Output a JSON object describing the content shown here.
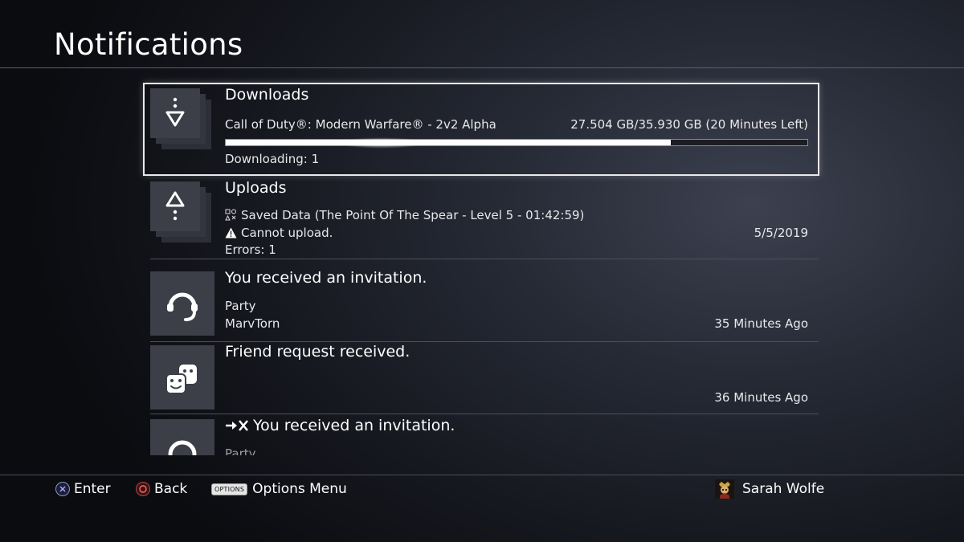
{
  "header": {
    "title": "Notifications"
  },
  "notifications": [
    {
      "title": "Downloads",
      "line1": "Call of Duty®: Modern Warfare® - 2v2 Alpha",
      "right1": "27.504 GB/35.930 GB (20 Minutes Left)",
      "progress_fraction": 0.765,
      "line3": "Downloading: 1",
      "icon": "download-icon"
    },
    {
      "title": "Uploads",
      "line1": "Saved Data (The Point Of The Spear - Level 5 - 01:42:59)",
      "line2": "Cannot upload.",
      "right2": "5/5/2019",
      "line3": "Errors: 1",
      "icon": "upload-icon"
    },
    {
      "title": "You received an invitation.",
      "line1": "Party",
      "line2": "MarvTorn",
      "right2": "35 Minutes Ago",
      "icon": "headset-icon"
    },
    {
      "title": "Friend request received.",
      "right2": "36 Minutes Ago",
      "icon": "friends-icon"
    },
    {
      "title": "You received an invitation.",
      "line1": "Party",
      "icon": "headset-icon"
    }
  ],
  "footer": {
    "enter_label": "Enter",
    "back_label": "Back",
    "options_tag": "OPTIONS",
    "options_label": "Options Menu",
    "user_name": "Sarah Wolfe"
  },
  "colors": {
    "focus_border": "#e9e9eb",
    "progress_fill": "#ffffff",
    "tile": "#3c3f48"
  }
}
